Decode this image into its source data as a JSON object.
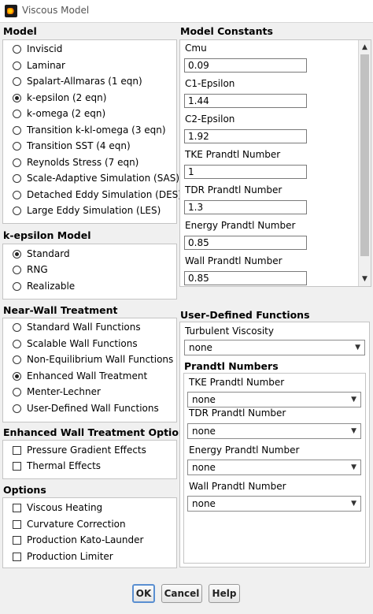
{
  "window": {
    "title": "Viscous Model"
  },
  "model": {
    "header": "Model",
    "options": [
      "Inviscid",
      "Laminar",
      "Spalart-Allmaras (1 eqn)",
      "k-epsilon (2 eqn)",
      "k-omega (2 eqn)",
      "Transition k-kl-omega (3 eqn)",
      "Transition SST (4 eqn)",
      "Reynolds Stress (7 eqn)",
      "Scale-Adaptive Simulation (SAS)",
      "Detached Eddy Simulation (DES)",
      "Large Eddy Simulation (LES)"
    ],
    "selected": "k-epsilon (2 eqn)"
  },
  "keps_model": {
    "header": "k-epsilon Model",
    "options": [
      "Standard",
      "RNG",
      "Realizable"
    ],
    "selected": "Standard"
  },
  "near_wall": {
    "header": "Near-Wall Treatment",
    "options": [
      "Standard Wall Functions",
      "Scalable Wall Functions",
      "Non-Equilibrium Wall Functions",
      "Enhanced Wall Treatment",
      "Menter-Lechner",
      "User-Defined Wall Functions"
    ],
    "selected": "Enhanced Wall Treatment"
  },
  "ewt_options": {
    "header": "Enhanced Wall Treatment Options",
    "items": [
      {
        "label": "Pressure Gradient Effects",
        "checked": false
      },
      {
        "label": "Thermal Effects",
        "checked": false
      }
    ]
  },
  "options": {
    "header": "Options",
    "items": [
      {
        "label": "Viscous Heating",
        "checked": false
      },
      {
        "label": "Curvature Correction",
        "checked": false
      },
      {
        "label": "Production Kato-Launder",
        "checked": false
      },
      {
        "label": "Production Limiter",
        "checked": false
      }
    ]
  },
  "constants": {
    "header": "Model Constants",
    "fields": [
      {
        "label": "Cmu",
        "value": "0.09"
      },
      {
        "label": "C1-Epsilon",
        "value": "1.44"
      },
      {
        "label": "C2-Epsilon",
        "value": "1.92"
      },
      {
        "label": "TKE Prandtl Number",
        "value": "1"
      },
      {
        "label": "TDR Prandtl Number",
        "value": "1.3"
      },
      {
        "label": "Energy Prandtl Number",
        "value": "0.85"
      },
      {
        "label": "Wall Prandtl Number",
        "value": "0.85"
      }
    ]
  },
  "udf": {
    "header": "User-Defined Functions",
    "turb_visc_label": "Turbulent Viscosity",
    "turb_visc_value": "none",
    "prandtl_header": "Prandtl Numbers",
    "prandtl": [
      {
        "label": "TKE Prandtl Number",
        "value": "none"
      },
      {
        "label": "TDR Prandtl Number",
        "value": "none"
      },
      {
        "label": "Energy Prandtl Number",
        "value": "none"
      },
      {
        "label": "Wall Prandtl Number",
        "value": "none"
      }
    ]
  },
  "buttons": {
    "ok": "OK",
    "cancel": "Cancel",
    "help": "Help"
  },
  "colors": {
    "ok_border": "#5a8fd1",
    "frame_border": "#c4c4c4",
    "background": "#f0f0f0"
  }
}
